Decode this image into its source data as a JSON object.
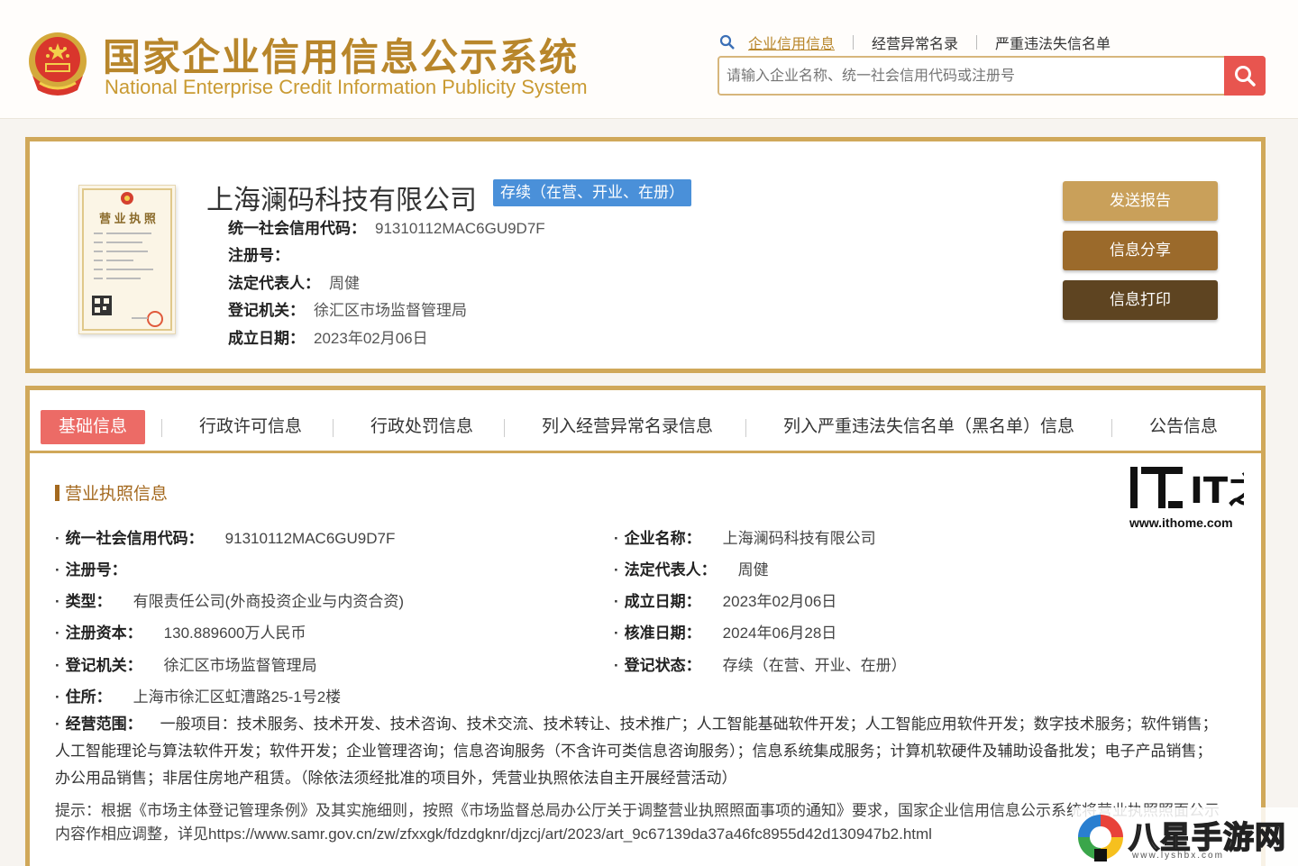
{
  "header": {
    "logo_cn": "国家企业信用信息公示系统",
    "logo_en": "National Enterprise Credit Information Publicity System",
    "nav": [
      "企业信用信息",
      "经营异常名录",
      "严重违法失信名单"
    ],
    "search_placeholder": "请输入企业名称、统一社会信用代码或注册号"
  },
  "company": {
    "name": "上海澜码科技有限公司",
    "status": "存续（在营、开业、在册）",
    "credit_code_label": "统一社会信用代码：",
    "credit_code": "91310112MAC6GU9D7F",
    "reg_no_label": "注册号：",
    "reg_no": "",
    "legal_rep_label": "法定代表人：",
    "legal_rep": "周健",
    "authority_label": "登记机关：",
    "authority": "徐汇区市场监督管理局",
    "established_label": "成立日期：",
    "established": "2023年02月06日",
    "license_caption": "营 业 执 照"
  },
  "actions": [
    "发送报告",
    "信息分享",
    "信息打印"
  ],
  "tabs": [
    "基础信息",
    "行政许可信息",
    "行政处罚信息",
    "列入经营异常名录信息",
    "列入严重违法失信名单（黑名单）信息",
    "公告信息"
  ],
  "section": {
    "title": "营业执照信息",
    "left": [
      {
        "label": "统一社会信用代码：",
        "value": "91310112MAC6GU9D7F"
      },
      {
        "label": "注册号：",
        "value": ""
      },
      {
        "label": "类型：",
        "value": "有限责任公司(外商投资企业与内资合资)"
      },
      {
        "label": "注册资本：",
        "value": "130.889600万人民币"
      },
      {
        "label": "登记机关：",
        "value": "徐汇区市场监督管理局"
      },
      {
        "label": "住所：",
        "value": "上海市徐汇区虹漕路25-1号2楼"
      }
    ],
    "right": [
      {
        "label": "企业名称：",
        "value": "上海澜码科技有限公司"
      },
      {
        "label": "法定代表人：",
        "value": "周健"
      },
      {
        "label": "成立日期：",
        "value": "2023年02月06日"
      },
      {
        "label": "核准日期：",
        "value": "2024年06月28日"
      },
      {
        "label": "登记状态：",
        "value": "存续（在营、开业、在册）"
      }
    ],
    "scope_label": "经营范围：",
    "scope_value": "一般项目：技术服务、技术开发、技术咨询、技术交流、技术转让、技术推广；人工智能基础软件开发；人工智能应用软件开发；数字技术服务；软件销售；人工智能理论与算法软件开发；软件开发；企业管理咨询；信息咨询服务（不含许可类信息咨询服务）；信息系统集成服务；计算机软硬件及辅助设备批发；电子产品销售；办公用品销售；非居住房地产租赁。（除依法须经批准的项目外，凭营业执照依法自主开展经营活动）",
    "tip": "提示：根据《市场主体登记管理条例》及其实施细则，按照《市场监督总局办公厅关于调整营业执照照面事项的通知》要求，国家企业信用信息公示系统将营业执照照面公示内容作相应调整，详见https://www.samr.gov.cn/zw/zfxxgk/fdzdgknr/djzcj/art/2023/art_9c67139da37a46fc8955d42d130947b2.html"
  },
  "watermarks": {
    "ithome_logo": "IT之家",
    "ithome_url": "www.ithome.com",
    "site_name": "八星手游网",
    "site_url": "www.lyshbx.com"
  },
  "icons": {
    "emblem": "national-emblem-icon",
    "search": "search-icon",
    "search_mini": "search-small-icon"
  },
  "colors": {
    "gold": "#d0a85a",
    "gold_text": "#b8862b",
    "tab_active": "#ec6b66",
    "status_blue": "#4a90d9",
    "btn_send": "#c9a05a",
    "btn_share": "#9b6a2b",
    "btn_print": "#5e4421",
    "search_red": "#e8554f"
  }
}
